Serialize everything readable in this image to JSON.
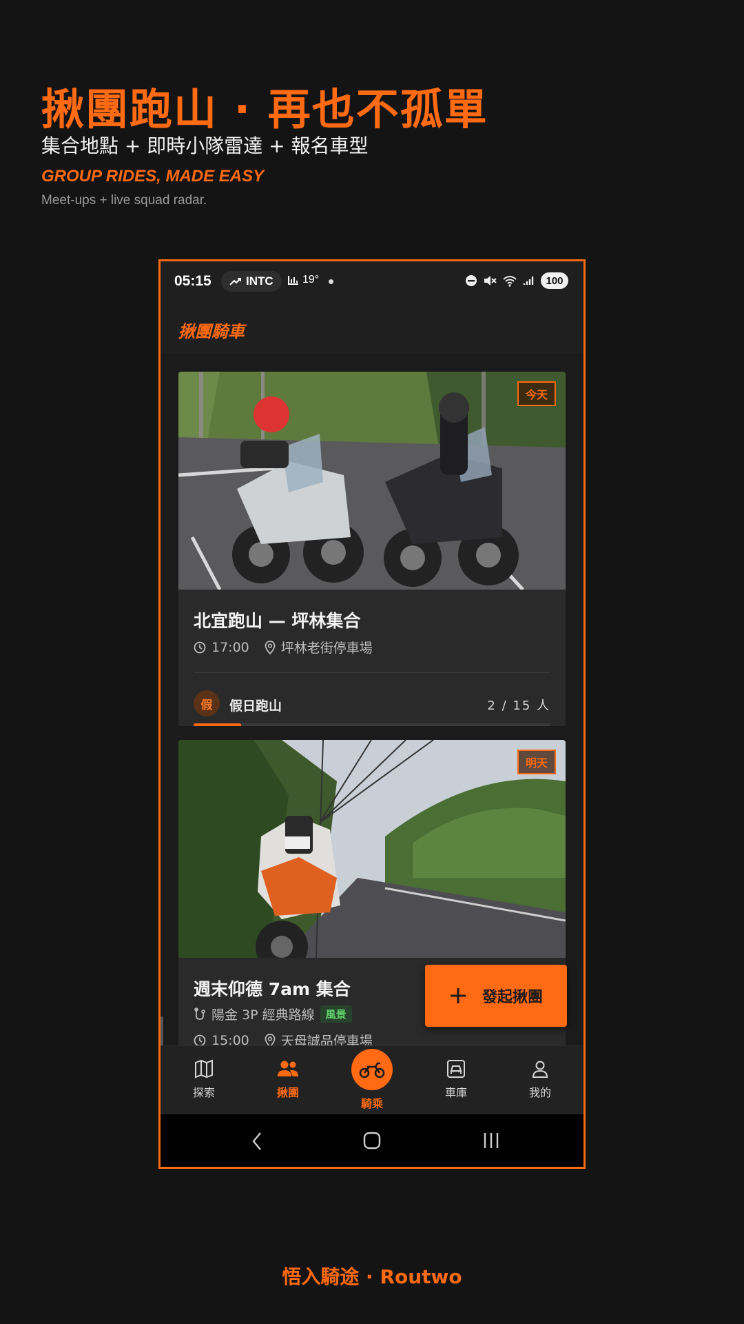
{
  "hero": {
    "title": "揪團跑山 · 再也不孤單",
    "subtitle": "集合地點 + 即時小隊雷達 + 報名車型",
    "en_title": "GROUP RIDES, MADE EASY",
    "en_subtitle": "Meet-ups + live squad radar."
  },
  "status_bar": {
    "time": "05:15",
    "ticker": "INTC",
    "temp": "19°",
    "battery": "100"
  },
  "app_bar": {
    "title": "揪團騎車"
  },
  "cards": [
    {
      "badge": "今天",
      "title": "北宜跑山 — 坪林集合",
      "time": "17:00",
      "location": "坪林老街停車場",
      "organizer_initial": "假",
      "organizer": "假日跑山",
      "count": "2 / 15 人",
      "joined": 2,
      "capacity": 15
    },
    {
      "badge": "明天",
      "title": "週末仰德 7am 集合",
      "route": "陽金 3P 經典路線",
      "tag": "風景",
      "time": "15:00",
      "location": "天母誠品停車場"
    }
  ],
  "fab": {
    "label": "發起揪團"
  },
  "bottom_nav": [
    {
      "label": "探索",
      "icon": "map-icon"
    },
    {
      "label": "揪團",
      "icon": "group-icon",
      "active": true
    },
    {
      "label": "騎乘",
      "icon": "motorcycle-icon"
    },
    {
      "label": "車庫",
      "icon": "garage-icon"
    },
    {
      "label": "我的",
      "icon": "profile-icon"
    }
  ],
  "colors": {
    "accent": "#ff6a12",
    "background": "#141414",
    "card": "#2a2a2a",
    "tag_green": "#5fd16b"
  },
  "footer": "悟入騎途 · Routwo"
}
